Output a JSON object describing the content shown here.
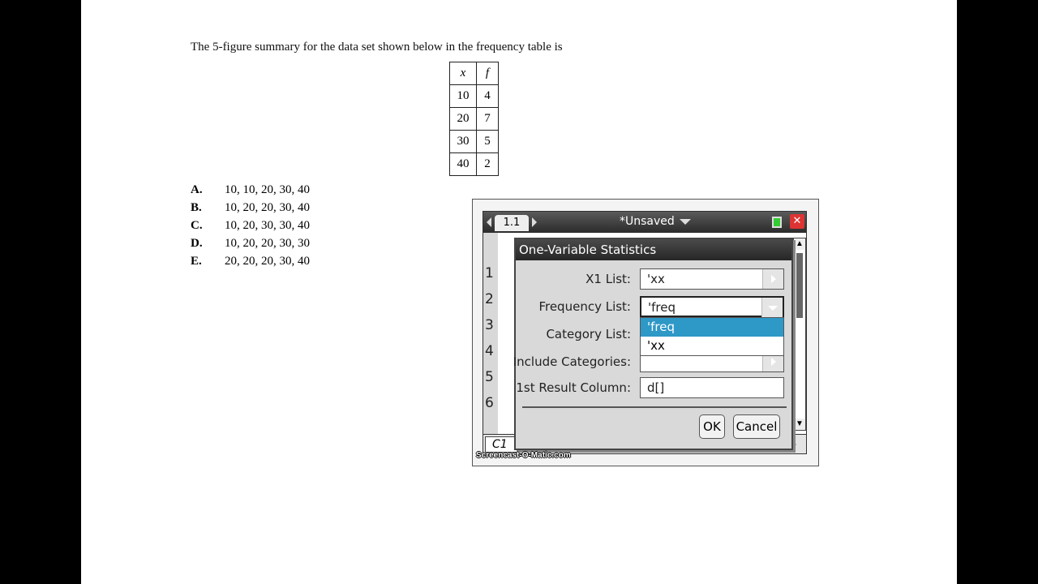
{
  "question": {
    "text": "The 5-figure summary for the data set shown below in the frequency table is",
    "table": {
      "headers": [
        "x",
        "f"
      ],
      "rows": [
        [
          "10",
          "4"
        ],
        [
          "20",
          "7"
        ],
        [
          "30",
          "5"
        ],
        [
          "40",
          "2"
        ]
      ]
    },
    "choices": [
      {
        "letter": "A.",
        "text": "10, 10, 20, 30, 40"
      },
      {
        "letter": "B.",
        "text": "10, 20, 20, 30, 40"
      },
      {
        "letter": "C.",
        "text": "10, 20, 30, 30, 40"
      },
      {
        "letter": "D.",
        "text": "10, 20, 20, 30, 30"
      },
      {
        "letter": "E.",
        "text": "20, 20, 20, 30, 40"
      }
    ]
  },
  "calculator": {
    "tab_label": "1.1",
    "doc_title": "*Unsaved",
    "row_numbers": [
      "1",
      "2",
      "3",
      "4",
      "5",
      "6"
    ],
    "cell_ref": "C1",
    "dialog": {
      "title": "One-Variable Statistics",
      "fields": {
        "x1_list_label": "X1 List:",
        "x1_list_value": "'xx",
        "frequency_list_label": "Frequency List:",
        "frequency_list_value": "'freq",
        "category_list_label": "Category List:",
        "include_categories_label": "Include Categories:",
        "result_column_label": "1st Result Column:",
        "result_column_value": "d[]"
      },
      "dropdown_options": [
        "'freq",
        "'xx"
      ],
      "ok_label": "OK",
      "cancel_label": "Cancel"
    }
  },
  "watermark": "Screencast-O-Matic.com"
}
